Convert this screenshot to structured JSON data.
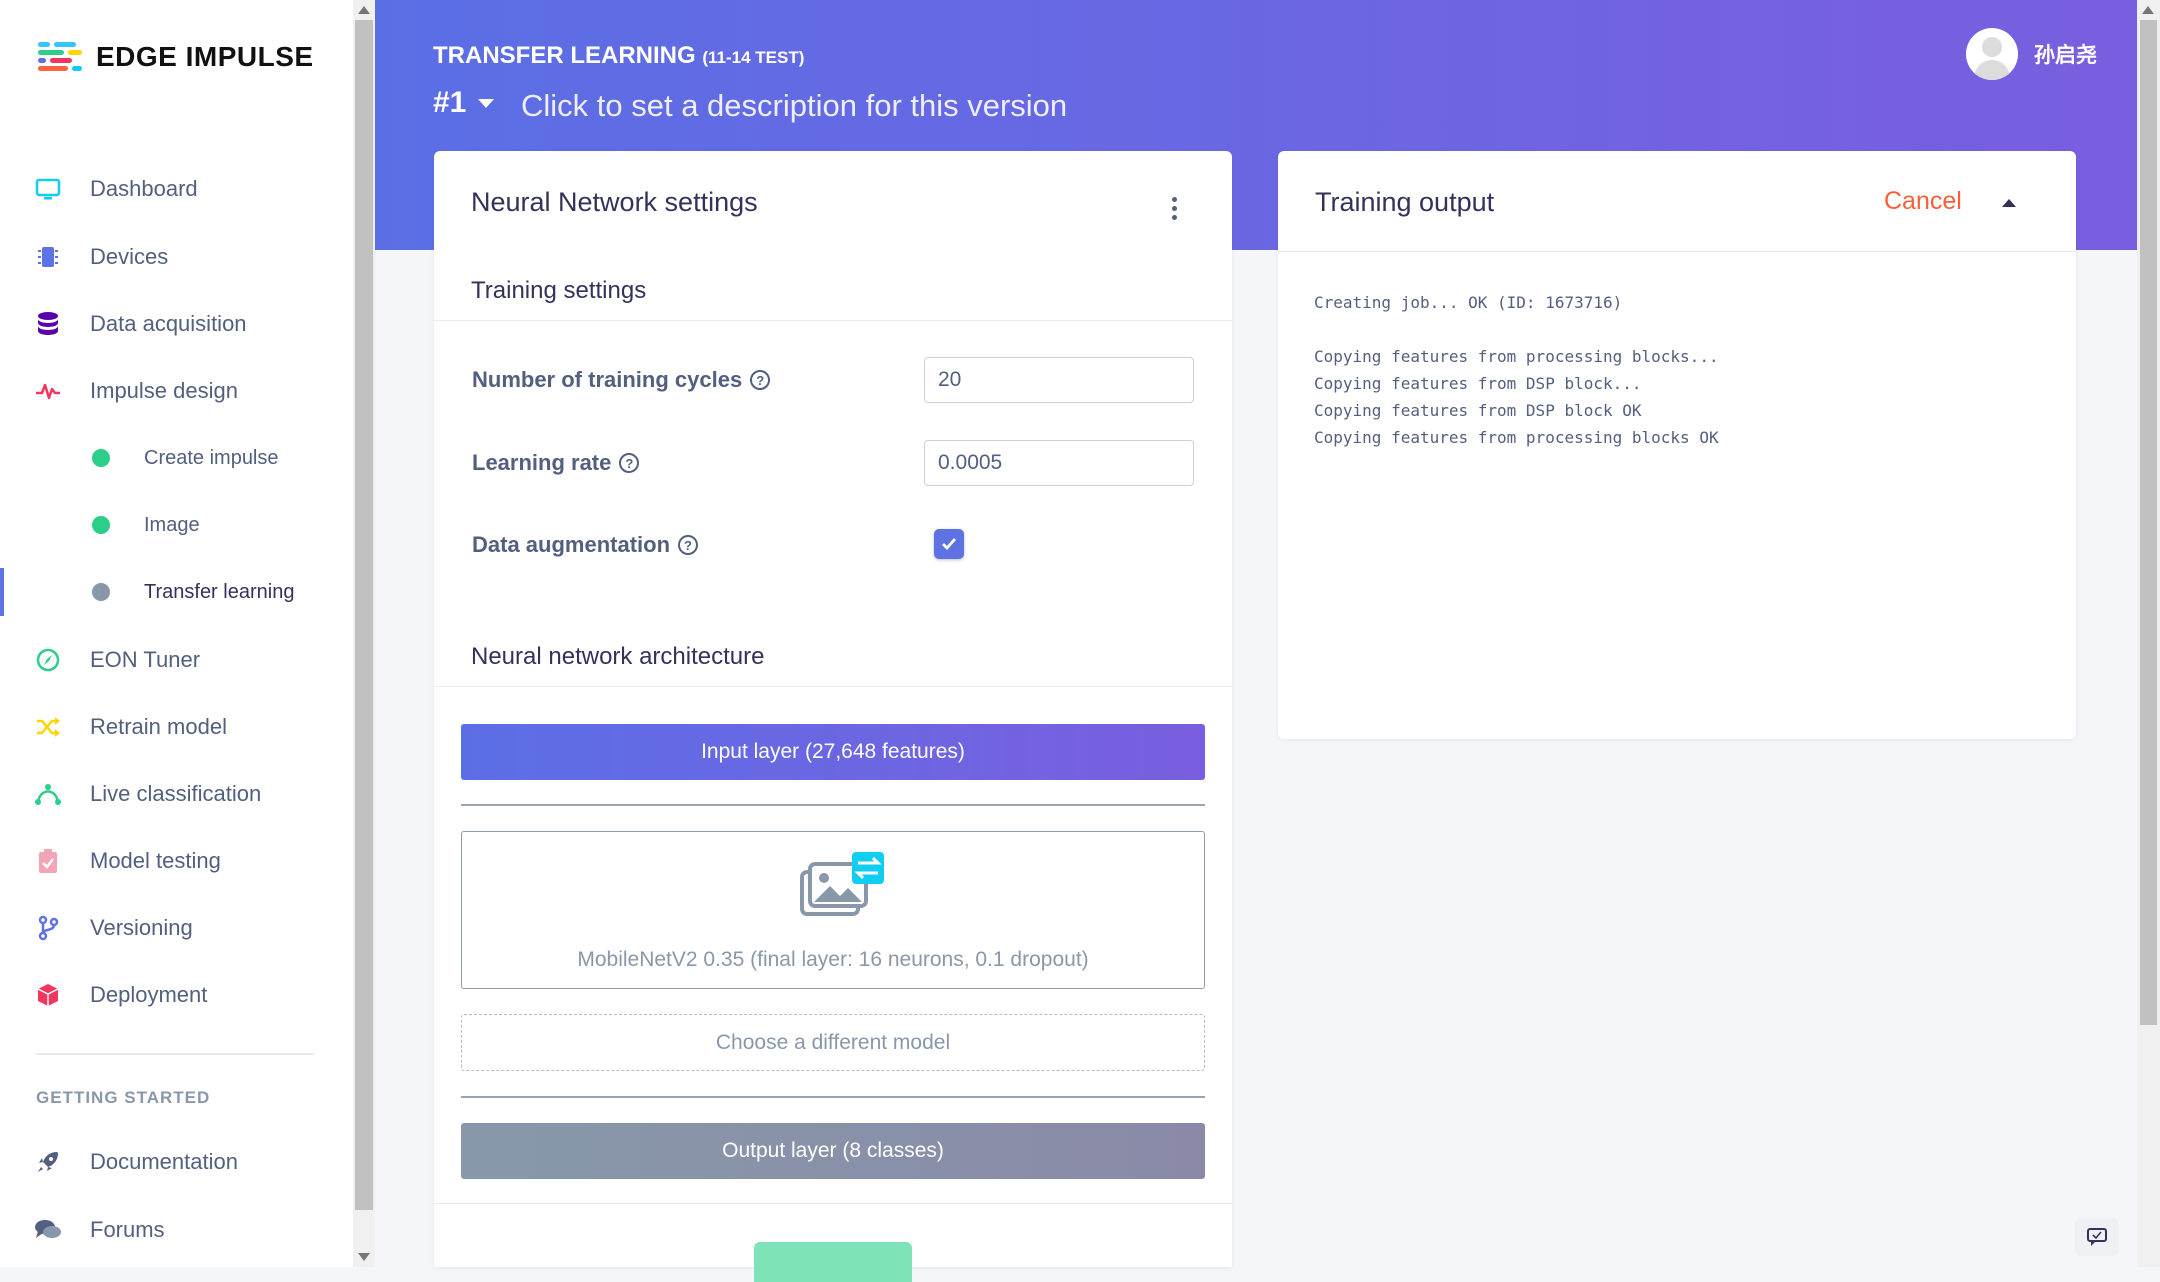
{
  "app": {
    "name": "EDGE IMPULSE"
  },
  "sidebar": {
    "items": [
      {
        "label": "Dashboard",
        "icon": "monitor-icon"
      },
      {
        "label": "Devices",
        "icon": "chip-icon"
      },
      {
        "label": "Data acquisition",
        "icon": "database-icon"
      },
      {
        "label": "Impulse design",
        "icon": "pulse-icon"
      },
      {
        "label": "Create impulse",
        "icon": "dot-green"
      },
      {
        "label": "Image",
        "icon": "dot-green"
      },
      {
        "label": "Transfer learning",
        "icon": "dot-gray"
      },
      {
        "label": "EON Tuner",
        "icon": "compass-icon"
      },
      {
        "label": "Retrain model",
        "icon": "shuffle-icon"
      },
      {
        "label": "Live classification",
        "icon": "bezier-icon"
      },
      {
        "label": "Model testing",
        "icon": "clipboard-check-icon"
      },
      {
        "label": "Versioning",
        "icon": "branch-icon"
      },
      {
        "label": "Deployment",
        "icon": "box-icon"
      }
    ],
    "section_heading": "GETTING STARTED",
    "getting_started": [
      {
        "label": "Documentation",
        "icon": "rocket-icon"
      },
      {
        "label": "Forums",
        "icon": "comments-icon"
      }
    ],
    "active_item": "Transfer learning"
  },
  "header": {
    "title": "TRANSFER LEARNING",
    "title_suffix": "(11-14 TEST)",
    "version": "#1",
    "version_description": "Click to set a description for this version",
    "user_name": "孙启尧"
  },
  "nn_settings": {
    "title": "Neural Network settings",
    "training_settings_title": "Training settings",
    "fields": {
      "cycles_label": "Number of training cycles",
      "cycles_value": "20",
      "lr_label": "Learning rate",
      "lr_value": "0.0005",
      "augmentation_label": "Data augmentation",
      "augmentation_checked": true
    },
    "architecture_title": "Neural network architecture",
    "input_layer": "Input layer (27,648 features)",
    "model": "MobileNetV2 0.35 (final layer: 16 neurons, 0.1 dropout)",
    "choose_model": "Choose a different model",
    "output_layer": "Output layer (8 classes)"
  },
  "training_output": {
    "title": "Training output",
    "cancel_label": "Cancel",
    "log": "Creating job... OK (ID: 1673716)\n\nCopying features from processing blocks...\nCopying features from DSP block...\nCopying features from DSP block OK\nCopying features from processing blocks OK"
  },
  "colors": {
    "brand_gradient_start": "#5b6fe5",
    "brand_gradient_end": "#7a5ee0",
    "cancel": "#f5603b",
    "status_done": "#2dce89",
    "status_current": "#8898aa"
  }
}
